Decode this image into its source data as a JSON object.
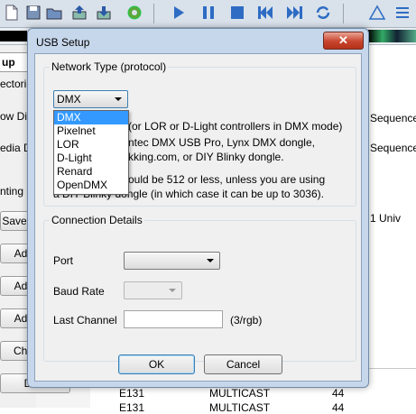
{
  "app": {
    "tab_setup": "up",
    "rows": [
      {
        "text": "ectorie"
      },
      {
        "text": "ow Di"
      },
      {
        "text": "edia D"
      },
      {
        "text": "nting"
      }
    ],
    "buttons": [
      {
        "label": "Save"
      },
      {
        "label": "Add"
      },
      {
        "label": "Add"
      },
      {
        "label": "Add"
      },
      {
        "label": "Cha"
      },
      {
        "label": "Dele"
      }
    ],
    "right_labels": [
      "Sequence",
      "Sequence",
      "1 Univ"
    ],
    "table_rows": [
      {
        "protocol": "E131",
        "mode": "MULTICAST",
        "count": "44"
      },
      {
        "protocol": "E131",
        "mode": "MULTICAST",
        "count": "44"
      }
    ]
  },
  "dialog": {
    "title": "USB Setup",
    "close_label": "✕",
    "network_group": {
      "legend": "Network Type (protocol)",
      "selected": "DMX",
      "options": [
        "DMX",
        "Pixelnet",
        "LOR",
        "D-Light",
        "Renard",
        "OpenDMX"
      ],
      "desc_line1": "(or LOR or D-Light controllers in DMX mode)",
      "desc_line2": "ntec DMX USB Pro, Lynx DMX dongle,",
      "desc_line3": "kking.com, or DIY Blinky dongle.",
      "desc_line4": "ould be 512 or less, unless you are using",
      "desc_line5": "a DIY Blinky dongle (in which case it can be up to 3036)."
    },
    "connection_group": {
      "legend": "Connection Details",
      "port_label": "Port",
      "port_value": "",
      "baud_label": "Baud Rate",
      "baud_value": "",
      "last_channel_label": "Last Channel",
      "last_channel_value": "",
      "last_channel_hint": "(3/rgb)"
    },
    "ok_label": "OK",
    "cancel_label": "Cancel"
  }
}
